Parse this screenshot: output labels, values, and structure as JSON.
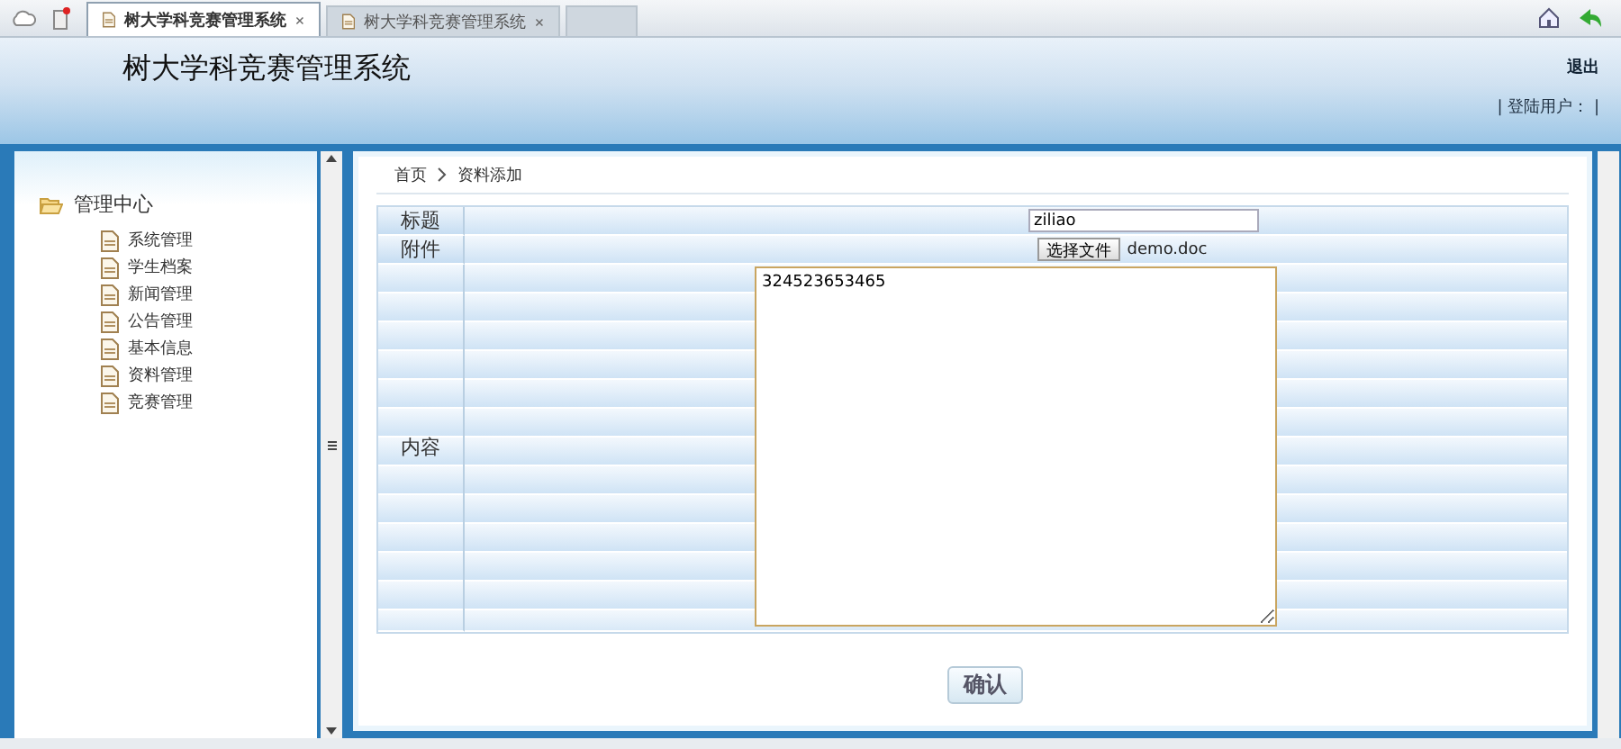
{
  "browser_tabs": [
    {
      "title": "树大学科竞赛管理系统",
      "selected": true
    },
    {
      "title": "树大学科竞赛管理系统",
      "selected": false
    }
  ],
  "header": {
    "title": "树大学科竞赛管理系统",
    "logout": "退出",
    "user_label": "| 登陆用户： |"
  },
  "sidebar": {
    "root": {
      "label": "管理中心",
      "expanded": true,
      "children": [
        {
          "label": "系统管理"
        },
        {
          "label": "学生档案"
        },
        {
          "label": "新闻管理"
        },
        {
          "label": "公告管理"
        },
        {
          "label": "基本信息"
        },
        {
          "label": "资料管理"
        },
        {
          "label": "竞赛管理"
        }
      ]
    }
  },
  "breadcrumb": [
    "首页",
    "资料添加"
  ],
  "form": [
    {
      "kind": "text",
      "label": "标题",
      "value": "ziliao"
    },
    {
      "kind": "file",
      "label": "附件",
      "button": "选择文件",
      "file_name": "demo.doc"
    },
    {
      "kind": "textarea",
      "label": "内容",
      "value": "324523653465"
    }
  ],
  "submit": "确认"
}
